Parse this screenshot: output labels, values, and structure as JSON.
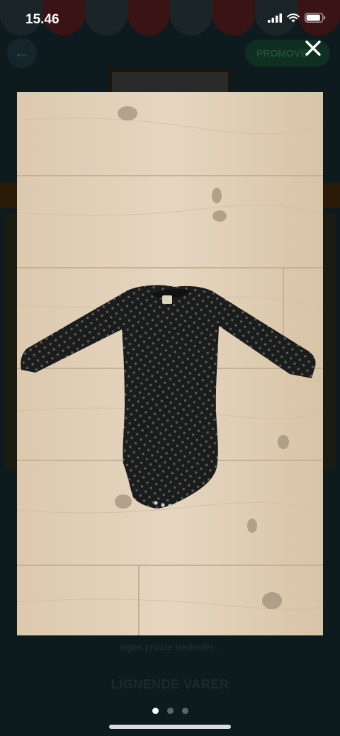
{
  "status_bar": {
    "time": "15.46",
    "battery_level": 0.9
  },
  "background": {
    "promo_label": "PROMOVE",
    "private_messages": "Ingen private beskeder...",
    "similar_items_heading": "LIGNENDE VARER",
    "awning_colors": [
      "#1b2527",
      "#3a1414",
      "#1b2527",
      "#3a1414",
      "#1b2527",
      "#3a1414",
      "#1b2527",
      "#3a1414"
    ]
  },
  "viewer": {
    "close_icon": "close-icon",
    "photo_subject": "baby-bodysuit-photo",
    "pagination": {
      "total": 3,
      "current": 1
    }
  },
  "colors": {
    "overlay": "#0a1518",
    "dot_active": "#ffffff",
    "dot_inactive": "#5d6568",
    "wood": "#e1cfb5",
    "garment": "#1a1b1d"
  }
}
